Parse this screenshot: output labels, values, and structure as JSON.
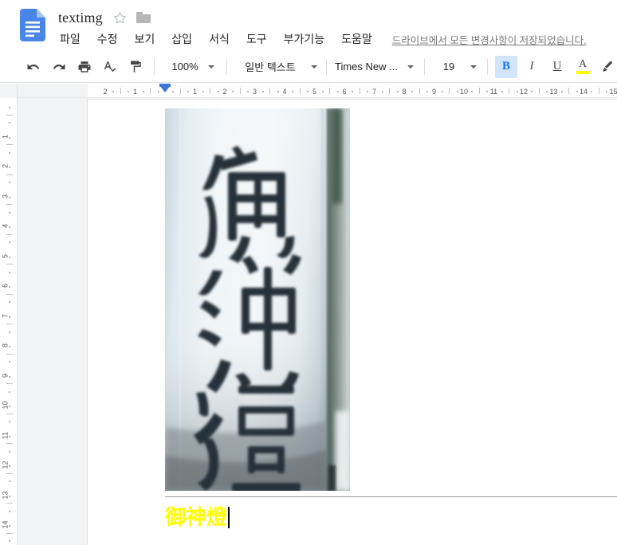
{
  "header": {
    "doc_icon": "google-docs-icon",
    "title": "textimg",
    "star_icon": "star-outline-icon",
    "folder_icon": "folder-icon",
    "menu_items": [
      {
        "label": "파일",
        "name": "menu-file"
      },
      {
        "label": "수정",
        "name": "menu-edit"
      },
      {
        "label": "보기",
        "name": "menu-view"
      },
      {
        "label": "삽입",
        "name": "menu-insert"
      },
      {
        "label": "서식",
        "name": "menu-format"
      },
      {
        "label": "도구",
        "name": "menu-tools"
      },
      {
        "label": "부가기능",
        "name": "menu-addons"
      },
      {
        "label": "도움말",
        "name": "menu-help"
      }
    ],
    "save_status": "드라이브에서 모든 변경사항이 저장되었습니다."
  },
  "toolbar": {
    "undo_icon": "undo-icon",
    "redo_icon": "redo-icon",
    "print_icon": "print-icon",
    "spellcheck_icon": "spellcheck-icon",
    "paint_format_icon": "paint-format-icon",
    "zoom_value": "100%",
    "style_value": "일반 텍스트",
    "font_value": "Times New ...",
    "font_size_value": "19",
    "bold_label": "B",
    "bold_active": true,
    "italic_label": "I",
    "underline_label": "U",
    "text_color_label": "A",
    "text_color_swatch": "#ffff00",
    "highlight_icon": "highlight-pen-icon",
    "link_icon": "insert-link-icon",
    "comment_icon": "add-comment-icon",
    "image_icon": "insert-image-icon"
  },
  "ruler": {
    "horizontal_labels": [
      "2",
      "1",
      "1",
      "2",
      "3",
      "4",
      "5",
      "6",
      "7",
      "8",
      "9",
      "10",
      "11",
      "12",
      "13",
      "14",
      "15"
    ],
    "vertical_labels": [
      "1",
      "2",
      "3",
      "4",
      "5",
      "6",
      "7",
      "8",
      "9",
      "10",
      "11",
      "12",
      "13",
      "14"
    ],
    "indent_marker": "left-indent-marker"
  },
  "document": {
    "image_alt": "lantern-photo-with-kanji",
    "image_text": "御神燈",
    "paragraph_text": "御神燈",
    "paragraph_color": "#ffff00",
    "cursor": "text-cursor"
  }
}
